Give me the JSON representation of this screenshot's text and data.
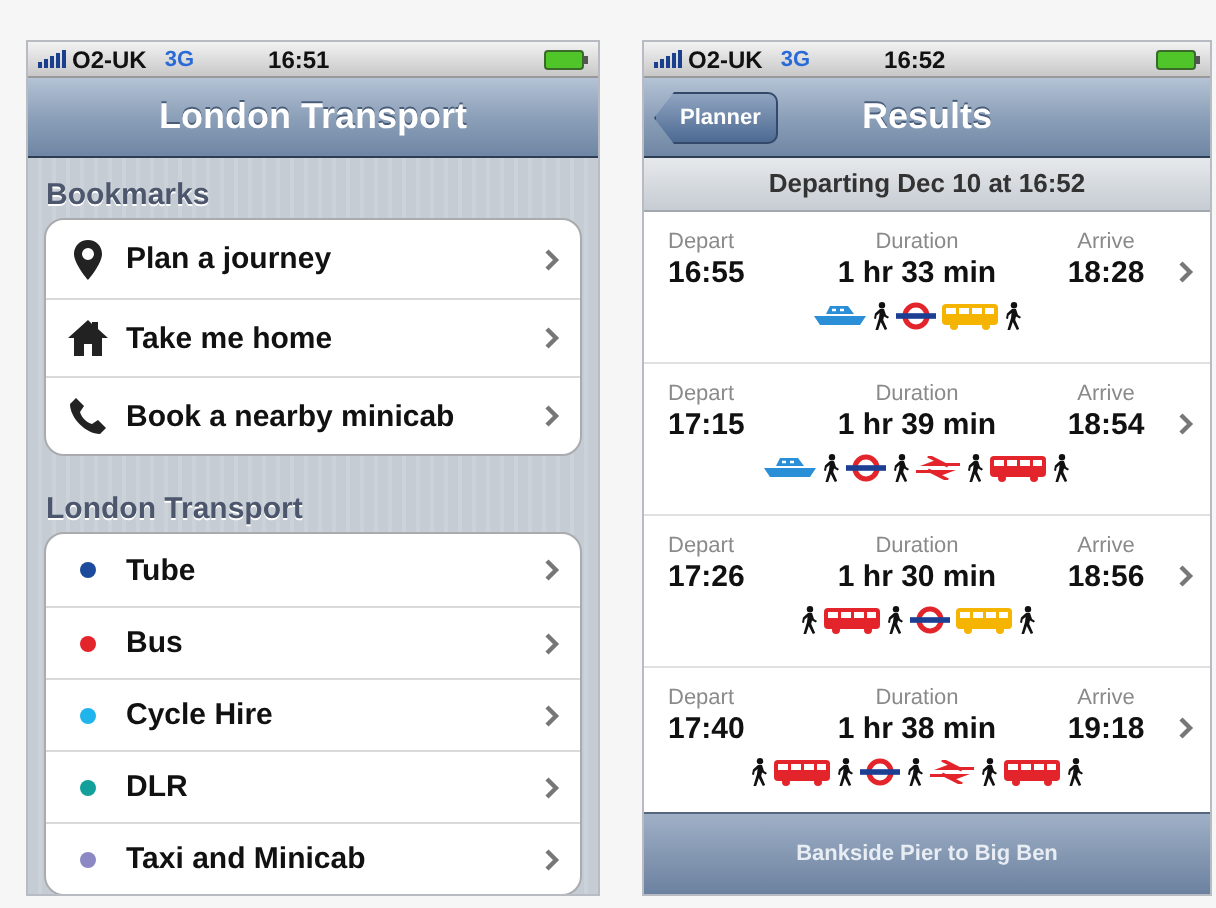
{
  "left": {
    "status": {
      "carrier": "O2-UK",
      "network": "3G",
      "time": "16:51"
    },
    "title": "London Transport",
    "sections": [
      {
        "header": "Bookmarks",
        "items": [
          {
            "label": "Plan a journey",
            "kind": "pin"
          },
          {
            "label": "Take me home",
            "kind": "house"
          },
          {
            "label": "Book a nearby minicab",
            "kind": "phone"
          }
        ]
      },
      {
        "header": "London Transport",
        "items": [
          {
            "label": "Tube",
            "kind": "dot",
            "color": "#1c4a9c"
          },
          {
            "label": "Bus",
            "kind": "dot",
            "color": "#e3242b"
          },
          {
            "label": "Cycle Hire",
            "kind": "dot",
            "color": "#1fb4ec"
          },
          {
            "label": "DLR",
            "kind": "dot",
            "color": "#14a09a"
          },
          {
            "label": "Taxi and Minicab",
            "kind": "dot",
            "color": "#8b88c4"
          }
        ]
      }
    ]
  },
  "right": {
    "status": {
      "carrier": "O2-UK",
      "network": "3G",
      "time": "16:52"
    },
    "back_button": "Planner",
    "title": "Results",
    "subheader": "Departing Dec 10 at 16:52",
    "results": [
      {
        "depart_label": "Depart",
        "depart": "16:55",
        "duration_label": "Duration",
        "duration": "1 hr 33 min",
        "arrive_label": "Arrive",
        "arrive": "18:28",
        "legs": [
          {
            "kind": "boat"
          },
          {
            "kind": "walk"
          },
          {
            "kind": "tube"
          },
          {
            "kind": "bus",
            "color": "#f5b400"
          },
          {
            "kind": "walk"
          }
        ]
      },
      {
        "depart_label": "Depart",
        "depart": "17:15",
        "duration_label": "Duration",
        "duration": "1 hr 39 min",
        "arrive_label": "Arrive",
        "arrive": "18:54",
        "legs": [
          {
            "kind": "boat"
          },
          {
            "kind": "walk"
          },
          {
            "kind": "tube"
          },
          {
            "kind": "walk"
          },
          {
            "kind": "rail"
          },
          {
            "kind": "walk"
          },
          {
            "kind": "bus",
            "color": "#e3242b"
          },
          {
            "kind": "walk"
          }
        ]
      },
      {
        "depart_label": "Depart",
        "depart": "17:26",
        "duration_label": "Duration",
        "duration": "1 hr 30 min",
        "arrive_label": "Arrive",
        "arrive": "18:56",
        "legs": [
          {
            "kind": "walk"
          },
          {
            "kind": "bus",
            "color": "#e3242b"
          },
          {
            "kind": "walk"
          },
          {
            "kind": "tube"
          },
          {
            "kind": "bus",
            "color": "#f5b400"
          },
          {
            "kind": "walk"
          }
        ]
      },
      {
        "depart_label": "Depart",
        "depart": "17:40",
        "duration_label": "Duration",
        "duration": "1 hr 38 min",
        "arrive_label": "Arrive",
        "arrive": "19:18",
        "legs": [
          {
            "kind": "walk"
          },
          {
            "kind": "bus",
            "color": "#e3242b"
          },
          {
            "kind": "walk"
          },
          {
            "kind": "tube"
          },
          {
            "kind": "walk"
          },
          {
            "kind": "rail"
          },
          {
            "kind": "walk"
          },
          {
            "kind": "bus",
            "color": "#e3242b"
          },
          {
            "kind": "walk"
          }
        ]
      }
    ],
    "footer": "Bankside Pier to Big Ben"
  }
}
